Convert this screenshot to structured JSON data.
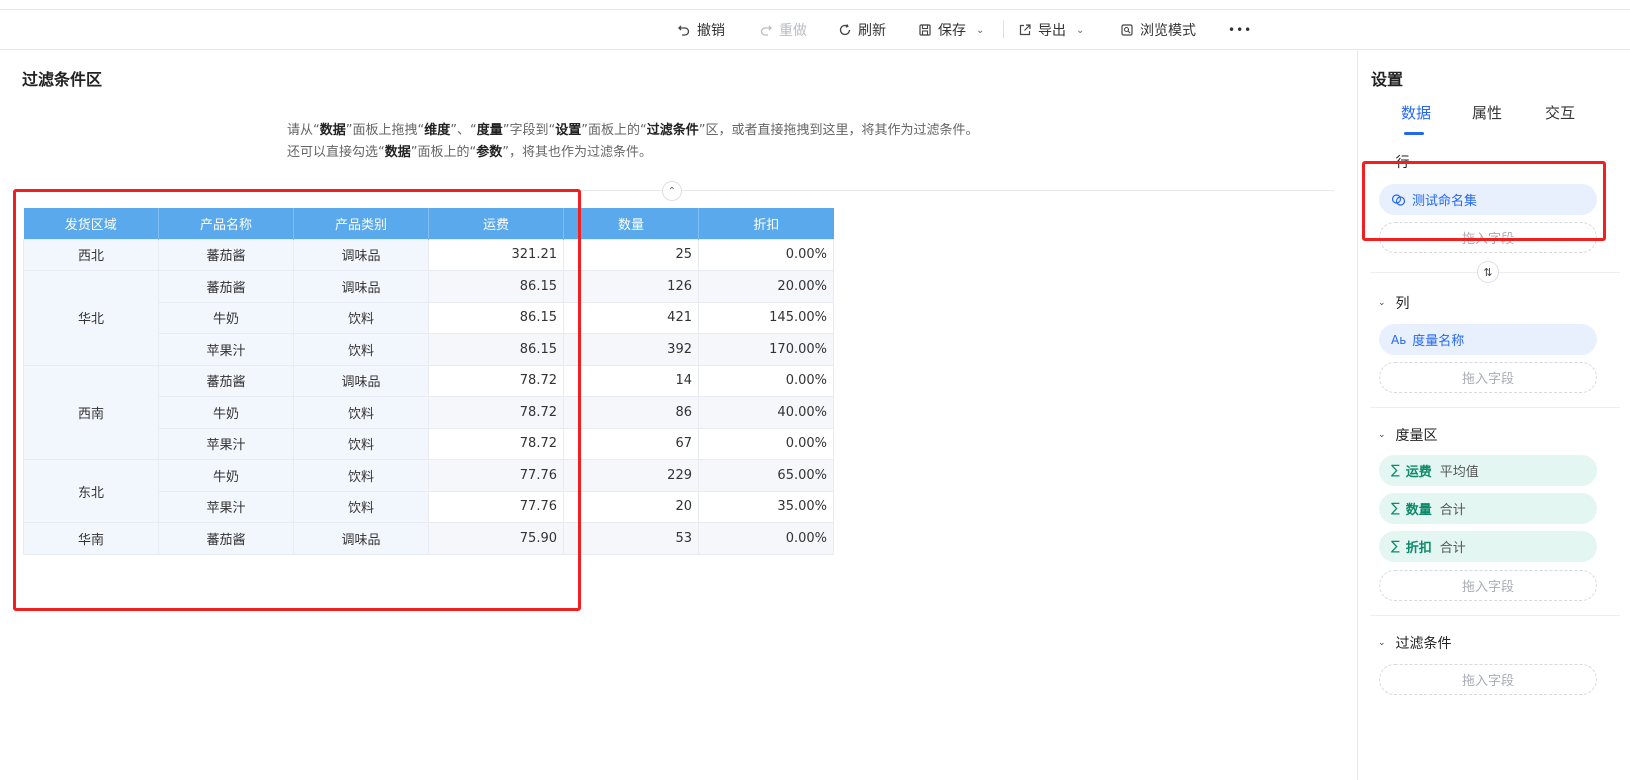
{
  "toolbar": {
    "undo": "撤销",
    "redo": "重做",
    "refresh": "刷新",
    "save": "保存",
    "export": "导出",
    "browse_mode": "浏览模式",
    "more": "•••"
  },
  "main": {
    "title": "过滤条件区",
    "hint_line1": {
      "p1": "请从“",
      "k1": "数据",
      "p2": "”面板上拖拽“",
      "k2": "维度",
      "p3": "”、“",
      "k3": "度量",
      "p4": "”字段到“",
      "k4": "设置",
      "p5": "”面板上的“",
      "k5": "过滤条件",
      "p6": "”区，或者直接拖拽到这里，将其作为过滤条件。"
    },
    "hint_line2": {
      "p1": "还可以直接勾选“",
      "k1": "数据",
      "p2": "”面板上的“",
      "k2": "参数",
      "p3": "”，将其也作为过滤条件。"
    },
    "collapse_glyph": "⌃"
  },
  "table": {
    "headers": [
      "发货区域",
      "产品名称",
      "产品类别",
      "运费",
      "数量",
      "折扣"
    ],
    "rows": [
      {
        "region": "西北",
        "product": "蕃茄酱",
        "category": "调味品",
        "freight": "321.21",
        "qty": "25",
        "discount": "0.00%"
      },
      {
        "region": "华北",
        "product": "蕃茄酱",
        "category": "调味品",
        "freight": "86.15",
        "qty": "126",
        "discount": "20.00%"
      },
      {
        "region": "",
        "product": "牛奶",
        "category": "饮料",
        "freight": "86.15",
        "qty": "421",
        "discount": "145.00%"
      },
      {
        "region": "",
        "product": "苹果汁",
        "category": "饮料",
        "freight": "86.15",
        "qty": "392",
        "discount": "170.00%"
      },
      {
        "region": "西南",
        "product": "蕃茄酱",
        "category": "调味品",
        "freight": "78.72",
        "qty": "14",
        "discount": "0.00%"
      },
      {
        "region": "",
        "product": "牛奶",
        "category": "饮料",
        "freight": "78.72",
        "qty": "86",
        "discount": "40.00%"
      },
      {
        "region": "",
        "product": "苹果汁",
        "category": "饮料",
        "freight": "78.72",
        "qty": "67",
        "discount": "0.00%"
      },
      {
        "region": "东北",
        "product": "牛奶",
        "category": "饮料",
        "freight": "77.76",
        "qty": "229",
        "discount": "65.00%"
      },
      {
        "region": "",
        "product": "苹果汁",
        "category": "饮料",
        "freight": "77.76",
        "qty": "20",
        "discount": "35.00%"
      },
      {
        "region": "华南",
        "product": "蕃茄酱",
        "category": "调味品",
        "freight": "75.90",
        "qty": "53",
        "discount": "0.00%"
      }
    ]
  },
  "panel": {
    "title": "设置",
    "tabs": [
      "数据",
      "属性",
      "交互"
    ],
    "rows_section": "行",
    "rows_pill": "测试命名集",
    "cols_section": "列",
    "cols_pill": "度量名称",
    "cols_pill_icon": "Aь",
    "measure_section": "度量区",
    "measures": [
      {
        "field": "运费",
        "agg": "平均值"
      },
      {
        "field": "数量",
        "agg": "合计"
      },
      {
        "field": "折扣",
        "agg": "合计"
      }
    ],
    "filter_section": "过滤条件",
    "drop_placeholder": "拖入字段",
    "sigma": "∑",
    "caret": "⌄",
    "swap_glyph": "⇅"
  },
  "colors": {
    "accent": "#2468f2",
    "header_blue": "#5aa9ec",
    "highlight_red": "#f02020"
  }
}
